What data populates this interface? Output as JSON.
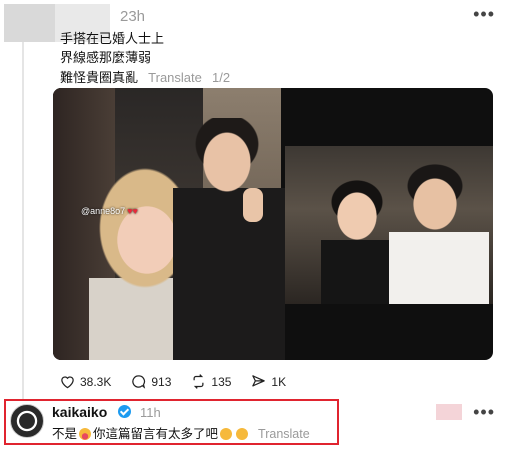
{
  "post": {
    "timestamp": "23h",
    "body_lines": [
      "手搭在已婚人士上",
      "界線感那麼薄弱",
      "難怪貴圈真亂"
    ],
    "translate_label": "Translate",
    "page_indicator": "1/2",
    "story_tag": "@anne8o7",
    "actions": {
      "likes": "38.3K",
      "comments": "913",
      "reposts": "135",
      "shares": "1K"
    }
  },
  "reply": {
    "username": "kaikaiko",
    "timestamp": "11h",
    "text_part1": "不是",
    "text_part2": "你這篇留言有太多了吧",
    "translate_label": "Translate"
  },
  "icons": {
    "like": "heart-icon",
    "comment": "comment-bubble-icon",
    "repost": "repost-icon",
    "share": "send-icon",
    "more": "more-dots-icon",
    "verified": "verified-badge-icon"
  },
  "colors": {
    "highlight_border": "#e0242f",
    "verified": "#1d9bf0",
    "muted_text": "#9a9a9a"
  }
}
